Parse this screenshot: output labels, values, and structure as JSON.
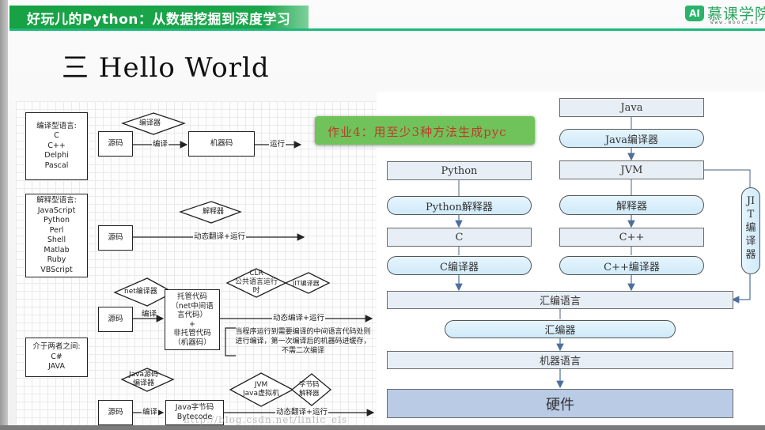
{
  "header": {
    "title": "好玩儿的Python：从数据挖掘到深度学习",
    "logo_badge": "AI",
    "logo_name": "慕课学院",
    "logo_url": "www.mooc.ai",
    "accent_color": "#17a245"
  },
  "slide": {
    "title": "三 Hello World",
    "homework": "作业4：用至少3种方法生成pyc",
    "watermark": "http://blog.csdn.net/linlic_els"
  },
  "left_diagram": {
    "compiled": {
      "languages": [
        "编译型语言:",
        "C",
        "C++",
        "Delphi",
        "Pascal"
      ],
      "source": "源码",
      "tool": "编译器",
      "step": "编译",
      "output": "机器码",
      "run": "运行"
    },
    "interpreted": {
      "languages": [
        "解释型语言:",
        "JavaScript",
        "Python",
        "Perl",
        "Shell",
        "Matlab",
        "Ruby",
        "VBScript"
      ],
      "source": "源码",
      "tool": "解释器",
      "step": "动态翻译+运行"
    },
    "hybrid": {
      "languages": [
        "介于两者之间:",
        "C#",
        "JAVA"
      ],
      "net": {
        "source": "源码",
        "tool": "net编译器",
        "step": "编译",
        "output_lines": [
          "托管代码",
          "（net中间语",
          "言代码）",
          "+",
          "非托管代码",
          "（机器码）"
        ],
        "runtime_lines": [
          "CLR",
          "公共语言运行",
          "时"
        ],
        "jit": "JIT编译器",
        "run": "动态编译+运行",
        "note_lines": [
          "当程序运行到需要编译的中间语言代码处则",
          "进行编译，第一次编译后的机器码进缓存，",
          "不需二次编译"
        ]
      },
      "java": {
        "source": "源码",
        "tool_lines": [
          "Java源码",
          "编译器"
        ],
        "step": "编译",
        "output_lines": [
          "Java字节码",
          "Bytecode"
        ],
        "jvm_lines": [
          "JVM",
          "Java虚拟机"
        ],
        "interp_lines": [
          "字节码",
          "解释器"
        ],
        "run": "动态翻译+运行"
      }
    }
  },
  "right_diagram": {
    "python_column": [
      "Python",
      "Python解释器",
      "C",
      "C编译器"
    ],
    "java_column": [
      "Java",
      "Java编译器",
      "JVM",
      "解释器",
      "C++",
      "C++编译器"
    ],
    "jit": "JIT编译器",
    "assembly": "汇编语言",
    "assembler": "汇编器",
    "machine": "机器语言",
    "hardware": "硬件"
  }
}
